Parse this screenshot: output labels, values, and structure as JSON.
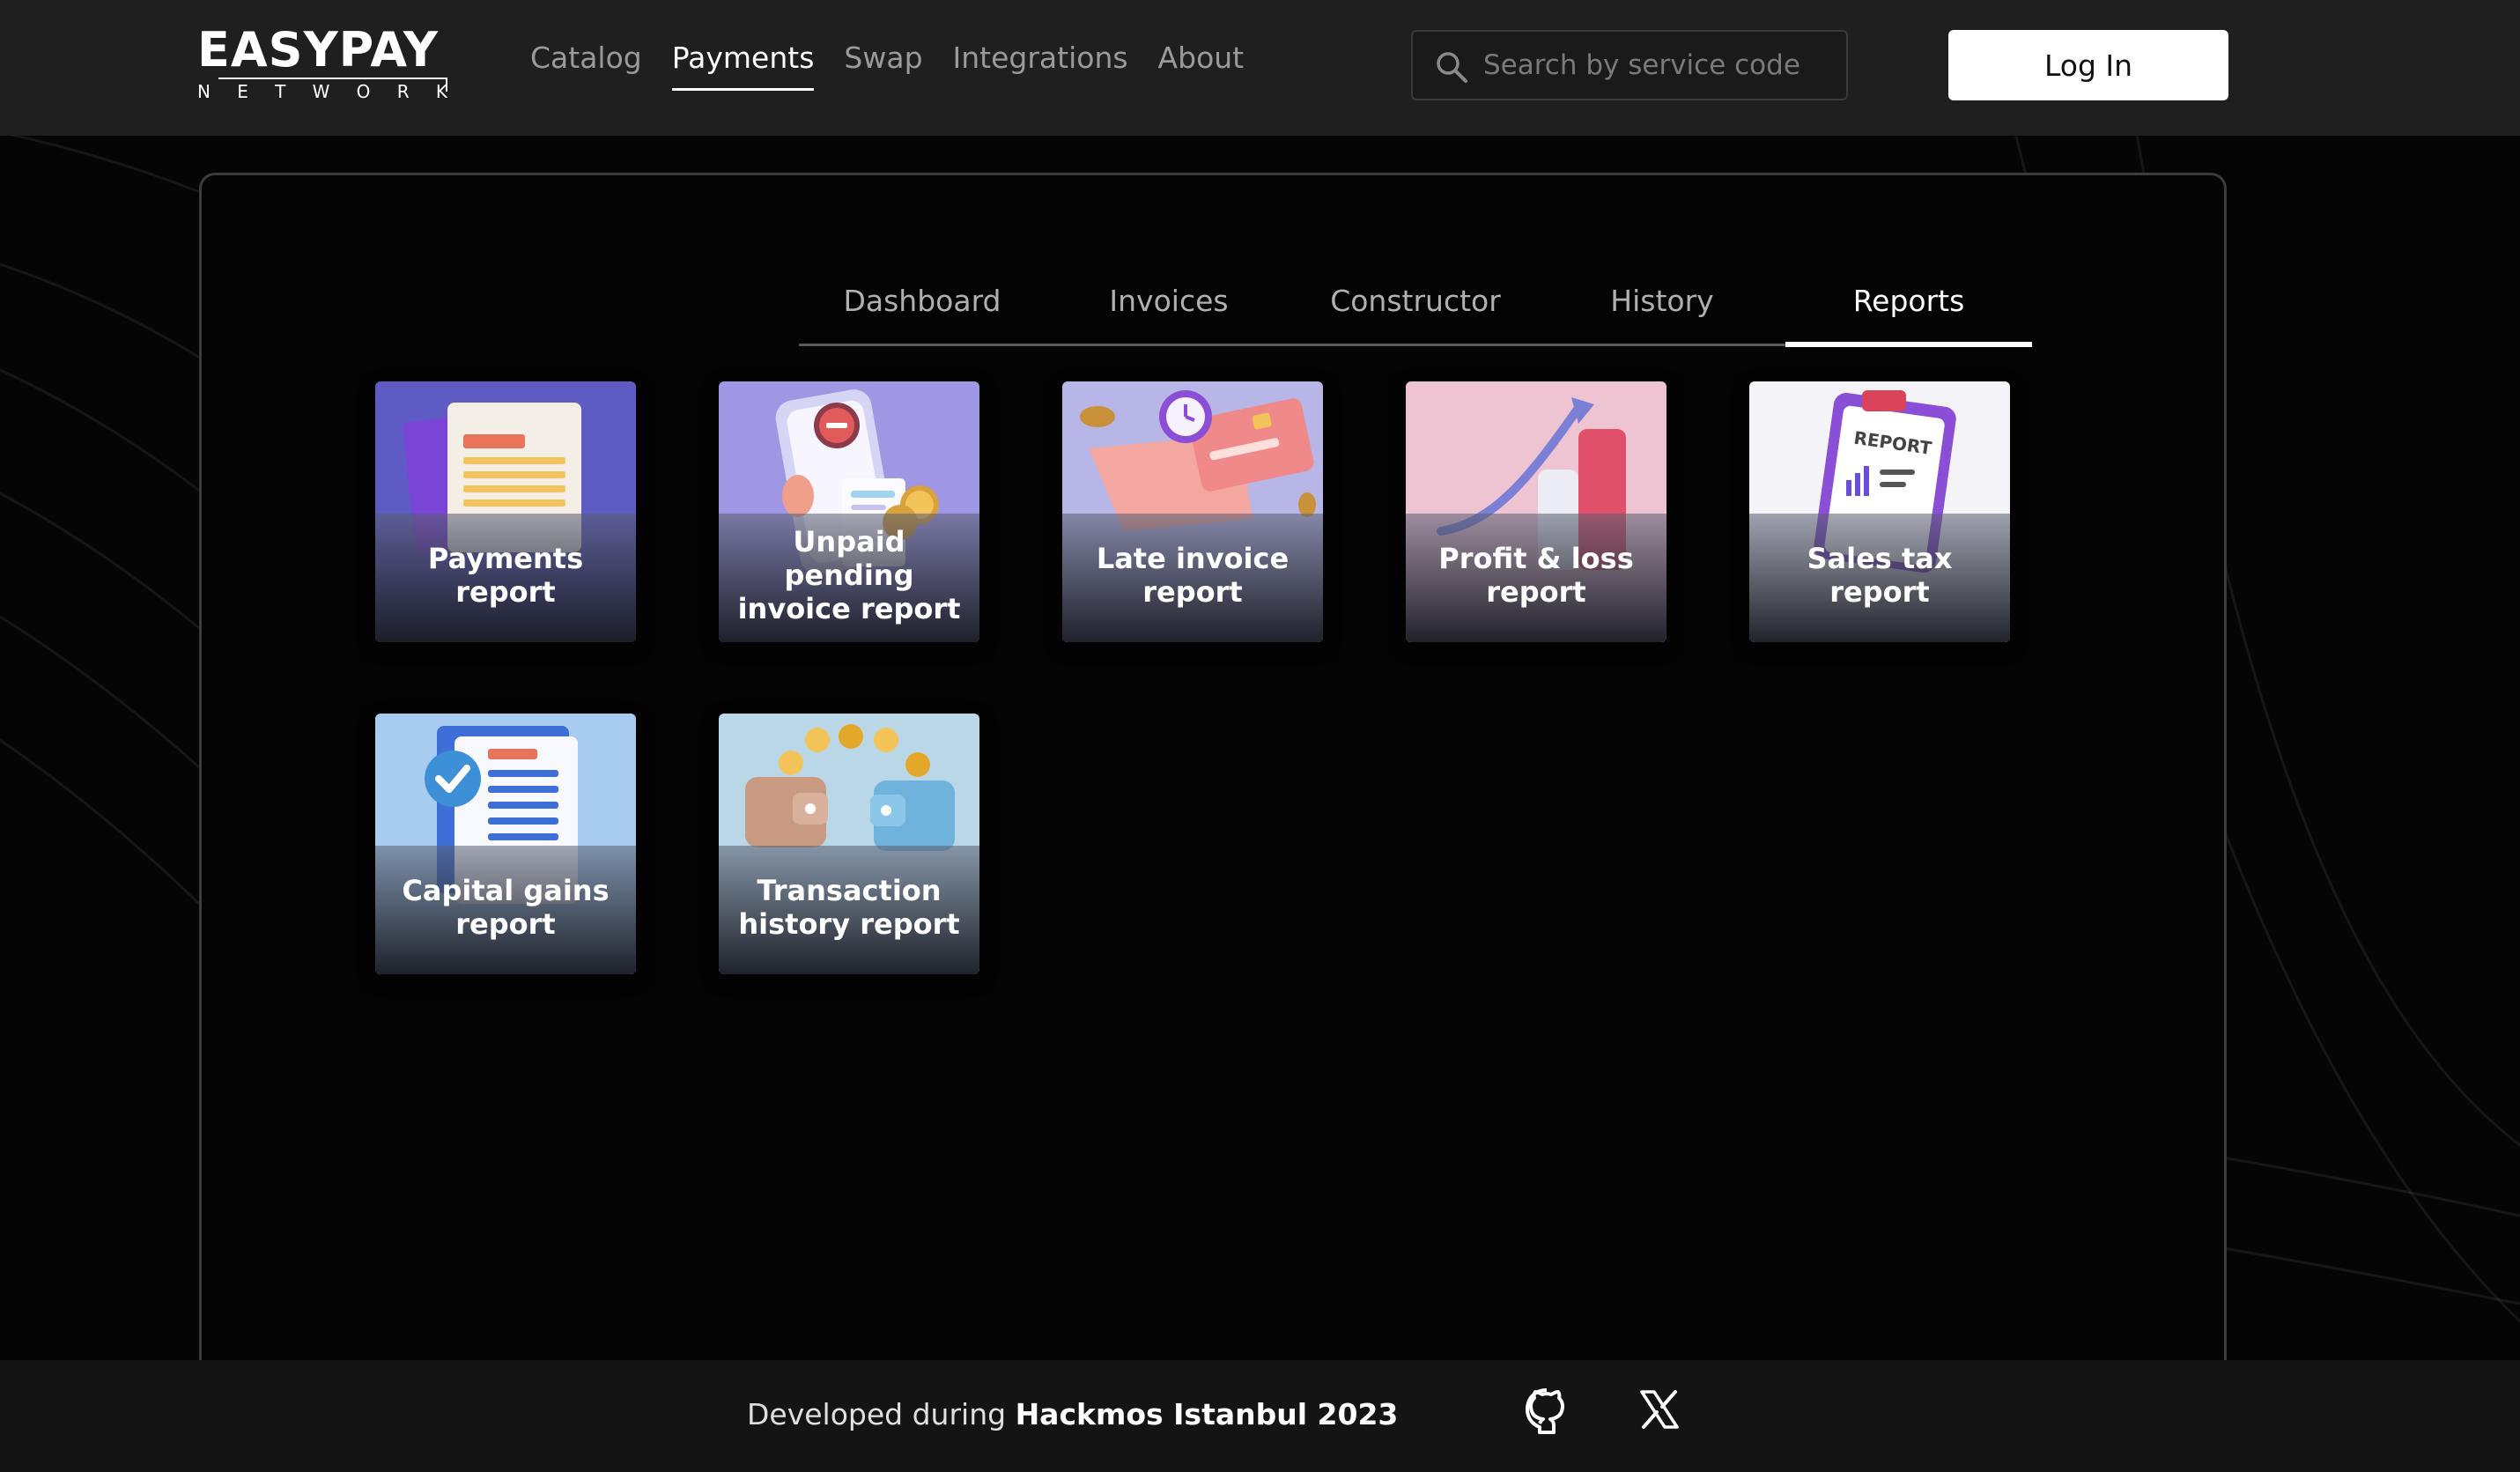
{
  "header": {
    "logo_top": "EASYPAY",
    "logo_bottom_letters": [
      "N",
      "E",
      "T",
      "W",
      "O",
      "R",
      "K"
    ],
    "nav": [
      {
        "label": "Catalog",
        "active": false
      },
      {
        "label": "Payments",
        "active": true
      },
      {
        "label": "Swap",
        "active": false
      },
      {
        "label": "Integrations",
        "active": false
      },
      {
        "label": "About",
        "active": false
      }
    ],
    "search_placeholder": "Search by service code",
    "search_icon": "search-icon",
    "login_label": "Log In"
  },
  "main": {
    "tabs": [
      {
        "label": "Dashboard",
        "active": false
      },
      {
        "label": "Invoices",
        "active": false
      },
      {
        "label": "Constructor",
        "active": false
      },
      {
        "label": "History",
        "active": false
      },
      {
        "label": "Reports",
        "active": true
      }
    ],
    "reports": [
      {
        "label": "Payments report",
        "icon": "documents-icon"
      },
      {
        "label": "Unpaid pending invoice report",
        "icon": "phone-invoice-icon"
      },
      {
        "label": "Late invoice report",
        "icon": "alarm-card-icon"
      },
      {
        "label": "Profit & loss report",
        "icon": "growth-chart-icon"
      },
      {
        "label": "Sales tax report",
        "icon": "clipboard-report-icon"
      },
      {
        "label": "Capital gains report",
        "icon": "checked-document-icon"
      },
      {
        "label": "Transaction history report",
        "icon": "wallets-coins-icon"
      }
    ]
  },
  "footer": {
    "prefix": "Developed during",
    "event": "Hackmos Istanbul 2023",
    "icons": [
      "github-icon",
      "x-icon"
    ]
  },
  "colors": {
    "background": "#050505",
    "header": "#1f1f1f",
    "accent": "#ffffff",
    "inactive_text": "#9a9a9a"
  }
}
